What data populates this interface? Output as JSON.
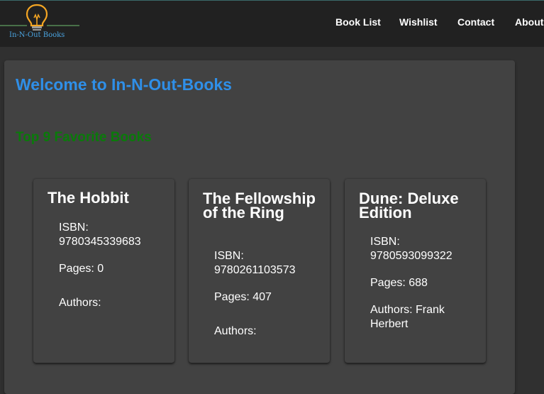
{
  "header": {
    "logo_text": "In-N-Out Books",
    "nav": [
      {
        "label": "Book List"
      },
      {
        "label": "Wishlist"
      },
      {
        "label": "Contact"
      },
      {
        "label": "About"
      }
    ]
  },
  "main": {
    "welcome": "Welcome to In-N-Out-Books",
    "top_heading": "Top 9 Favorite Books",
    "books": [
      {
        "title": "The Hobbit",
        "isbn_label": "ISBN:",
        "isbn": "9780345339683",
        "pages": "Pages: 0",
        "authors": "Authors:"
      },
      {
        "title": "The Fellowship of the Ring",
        "isbn_label": "ISBN:",
        "isbn": "9780261103573",
        "pages": "Pages: 407",
        "authors": "Authors:"
      },
      {
        "title": "Dune: Deluxe Edition",
        "isbn_label": "ISBN:",
        "isbn": "9780593099322",
        "pages": "Pages: 688",
        "authors": "Authors: Frank Herbert"
      }
    ]
  },
  "colors": {
    "header_bg": "#212121",
    "page_bg": "#303030",
    "card_bg": "#424242",
    "welcome": "#2f8fe8",
    "top_heading": "#0a7a0a",
    "logo_text": "#4aa3df",
    "bulb": "#f5a623"
  },
  "icons": {
    "logo": "lightbulb-icon"
  }
}
